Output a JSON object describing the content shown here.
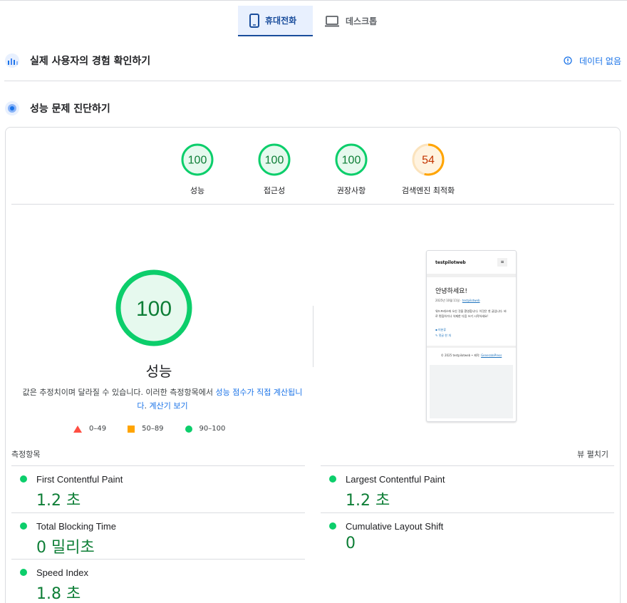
{
  "device_tabs": [
    {
      "label": "휴대전화",
      "icon": "smartphone-icon",
      "active": true
    },
    {
      "label": "데스크톱",
      "icon": "laptop-icon",
      "active": false
    }
  ],
  "field_section": {
    "title": "실제 사용자의 경험 확인하기",
    "no_data": "데이터 없음"
  },
  "lab_section": {
    "title": "성능 문제 진단하기"
  },
  "categories": [
    {
      "label": "성능",
      "score": "100",
      "value": 100,
      "color": "#0cce6b"
    },
    {
      "label": "접근성",
      "score": "100",
      "value": 100,
      "color": "#0cce6b"
    },
    {
      "label": "권장사항",
      "score": "100",
      "value": 100,
      "color": "#0cce6b"
    },
    {
      "label": "검색엔진 최적화",
      "score": "54",
      "value": 54,
      "color": "#ffa400"
    }
  ],
  "performance": {
    "score": "100",
    "title": "성능",
    "desc_before": "값은 추정치이며 달라질 수 있습니다. 이러한 측정항목에서 ",
    "desc_link1": "성능 점수가 직접 계산됩니다",
    "desc_mid": ". ",
    "desc_link2": "계산기 보기"
  },
  "legend": [
    {
      "shape": "triangle",
      "range": "0–49",
      "color": "#ff4e42"
    },
    {
      "shape": "square",
      "range": "50–89",
      "color": "#ffa400"
    },
    {
      "shape": "circle",
      "range": "90–100",
      "color": "#0cce6b"
    }
  ],
  "screenshot": {
    "site_name": "testpilotweb",
    "menu_icon": "≡",
    "heading": "안녕하세요!",
    "meta_date": "2025년 10월 11일 · ",
    "meta_author": "testpilotweb",
    "body_text": "워드프레스에 오신 것을 환영합니다. 이것은 첫 글입니다. 바로 편집하거나 삭제한 다음 쓰기 시작하세요!",
    "category": "미분류",
    "comment": "댓글 한 개",
    "footer_text": "© 2025 testpilotweb • 제작: ",
    "footer_link": "GeneratePress"
  },
  "metrics_header": {
    "title": "측정항목",
    "expand": "뷰 펼치기"
  },
  "metrics": [
    {
      "name": "First Contentful Paint",
      "value": "1.2 초"
    },
    {
      "name": "Largest Contentful Paint",
      "value": "1.2 초"
    },
    {
      "name": "Total Blocking Time",
      "value": "0 밀리초"
    },
    {
      "name": "Cumulative Layout Shift",
      "value": "0"
    },
    {
      "name": "Speed Index",
      "value": "1.8 초"
    }
  ],
  "colors": {
    "pass": "#0cce6b",
    "average": "#ffa400",
    "fail": "#ff4e42",
    "link": "#1a73e8",
    "metric_value": "#0d7e36"
  }
}
